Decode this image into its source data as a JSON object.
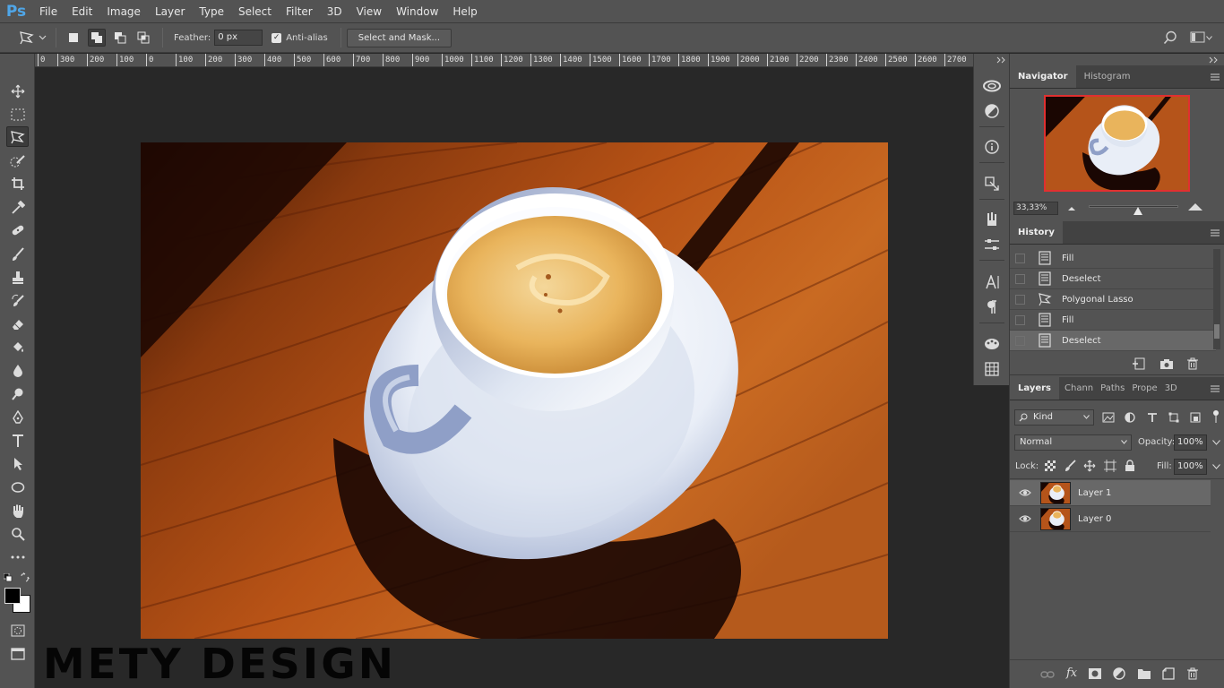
{
  "app": {
    "logo": "Ps"
  },
  "menu": [
    "File",
    "Edit",
    "Image",
    "Layer",
    "Type",
    "Select",
    "Filter",
    "3D",
    "View",
    "Window",
    "Help"
  ],
  "options": {
    "feather_label": "Feather:",
    "feather_value": "0 px",
    "antialias_label": "Anti-alias",
    "select_mask_label": "Select and Mask..."
  },
  "ruler": {
    "ticks": [
      "0",
      "300",
      "200",
      "100",
      "0",
      "100",
      "200",
      "300",
      "400",
      "500",
      "600",
      "700",
      "800",
      "900",
      "1000",
      "1100",
      "1200",
      "1300",
      "1400",
      "1500",
      "1600",
      "1700",
      "1800",
      "1900",
      "2000",
      "2100",
      "2200",
      "2300",
      "2400",
      "2500",
      "2600",
      "2700"
    ]
  },
  "navigator": {
    "tabs": [
      "Navigator",
      "Histogram"
    ],
    "zoom": "33,33%",
    "zoom_slider": 0.55
  },
  "history": {
    "title": "History",
    "items": [
      {
        "label": "Fill",
        "icon": "document-icon"
      },
      {
        "label": "Deselect",
        "icon": "document-icon"
      },
      {
        "label": "Polygonal Lasso",
        "icon": "lasso-icon"
      },
      {
        "label": "Fill",
        "icon": "document-icon"
      },
      {
        "label": "Deselect",
        "icon": "document-icon",
        "selected": true
      }
    ]
  },
  "layers_panel": {
    "tabs": [
      "Layers",
      "Chann",
      "Paths",
      "Prope",
      "3D"
    ],
    "filter_kind": "Kind",
    "blend_mode": "Normal",
    "opacity_label": "Opacity:",
    "opacity_value": "100%",
    "lock_label": "Lock:",
    "fill_label": "Fill:",
    "fill_value": "100%",
    "layers": [
      {
        "name": "Layer 1",
        "selected": true
      },
      {
        "name": "Layer 0",
        "selected": false
      }
    ]
  },
  "watermark": "METY DESIGN",
  "colors": {
    "chrome": "#535353",
    "workspace": "#282828",
    "selection": "#686868",
    "nav_frame": "#e03030",
    "ps_blue": "#4fa6e8"
  }
}
